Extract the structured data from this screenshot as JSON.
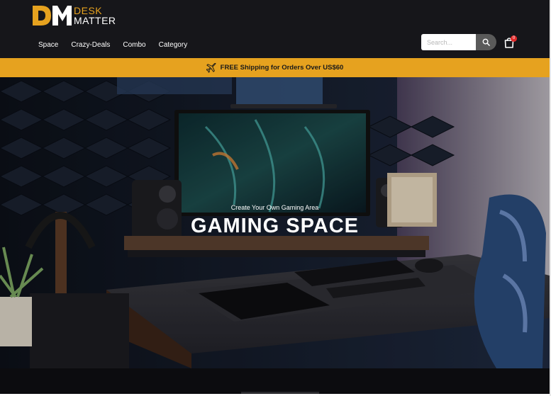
{
  "brand": {
    "line1": "DESK",
    "line2": "MATTER",
    "accent_color": "#e6a21f",
    "mark_icon": "dm-logo-icon"
  },
  "nav": {
    "items": [
      {
        "label": "Space"
      },
      {
        "label": "Crazy-Deals"
      },
      {
        "label": "Combo"
      },
      {
        "label": "Category"
      }
    ]
  },
  "search": {
    "placeholder": "Search...",
    "icon": "search-icon"
  },
  "cart": {
    "icon": "shopping-bag-icon",
    "count": "0",
    "badge_color": "#e12b2b"
  },
  "promo": {
    "icon": "airplane-icon",
    "text": "FREE Shipping for Orders Over US$60",
    "background": "#e6a21f"
  },
  "hero": {
    "tagline": "Create Your Own Gaming Area",
    "title": "GAMING SPACE",
    "image_subject": "gaming desk setup photo"
  }
}
